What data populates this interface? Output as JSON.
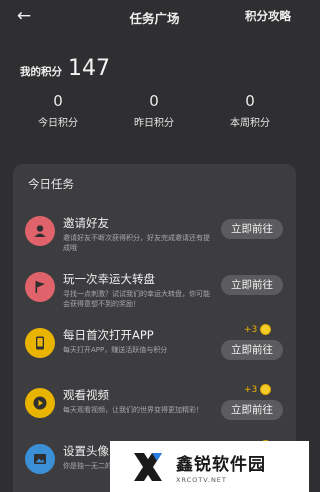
{
  "header": {
    "back_icon": "arrow-left-icon",
    "title": "任务广场",
    "rules_link": "积分攻略"
  },
  "points": {
    "label": "我的积分",
    "value": "147"
  },
  "stats": [
    {
      "value": "0",
      "label": "今日积分"
    },
    {
      "value": "0",
      "label": "昨日积分"
    },
    {
      "value": "0",
      "label": "本周积分"
    }
  ],
  "tasks_panel": {
    "title": "今日任务",
    "tasks": [
      {
        "name": "邀请好友",
        "desc": "邀请好友不断次获得积分，好友完成邀请还有提成哦",
        "button": "立即前往",
        "reward": "",
        "icon": "user-icon",
        "icon_color": "#e0626a"
      },
      {
        "name": "玩一次幸运大转盘",
        "desc": "寻找一点刺激？试试我们的幸运大转盘，你可能会获得意想不到的奖励！",
        "button": "立即前往",
        "reward": "",
        "icon": "flag-icon",
        "icon_color": "#e0626a"
      },
      {
        "name": "每日首次打开APP",
        "desc": "每天打开APP，赚送活跃值与积分",
        "button": "立即前往",
        "reward": "+3",
        "icon": "phone-icon",
        "icon_color": "#e8b400"
      },
      {
        "name": "观看视频",
        "desc": "每天观看视频，让我们的世界变得更加精彩！",
        "button": "立即前往",
        "reward": "+3",
        "icon": "play-icon",
        "icon_color": "#e8b400"
      },
      {
        "name": "设置头像",
        "desc": "你是独一无二的，让大家一",
        "button": "",
        "reward": "+5",
        "icon": "image-icon",
        "icon_color": "#3b8fd6"
      }
    ]
  },
  "watermark": {
    "name": "鑫锐软件园",
    "url": "XRCOTV.NET"
  }
}
